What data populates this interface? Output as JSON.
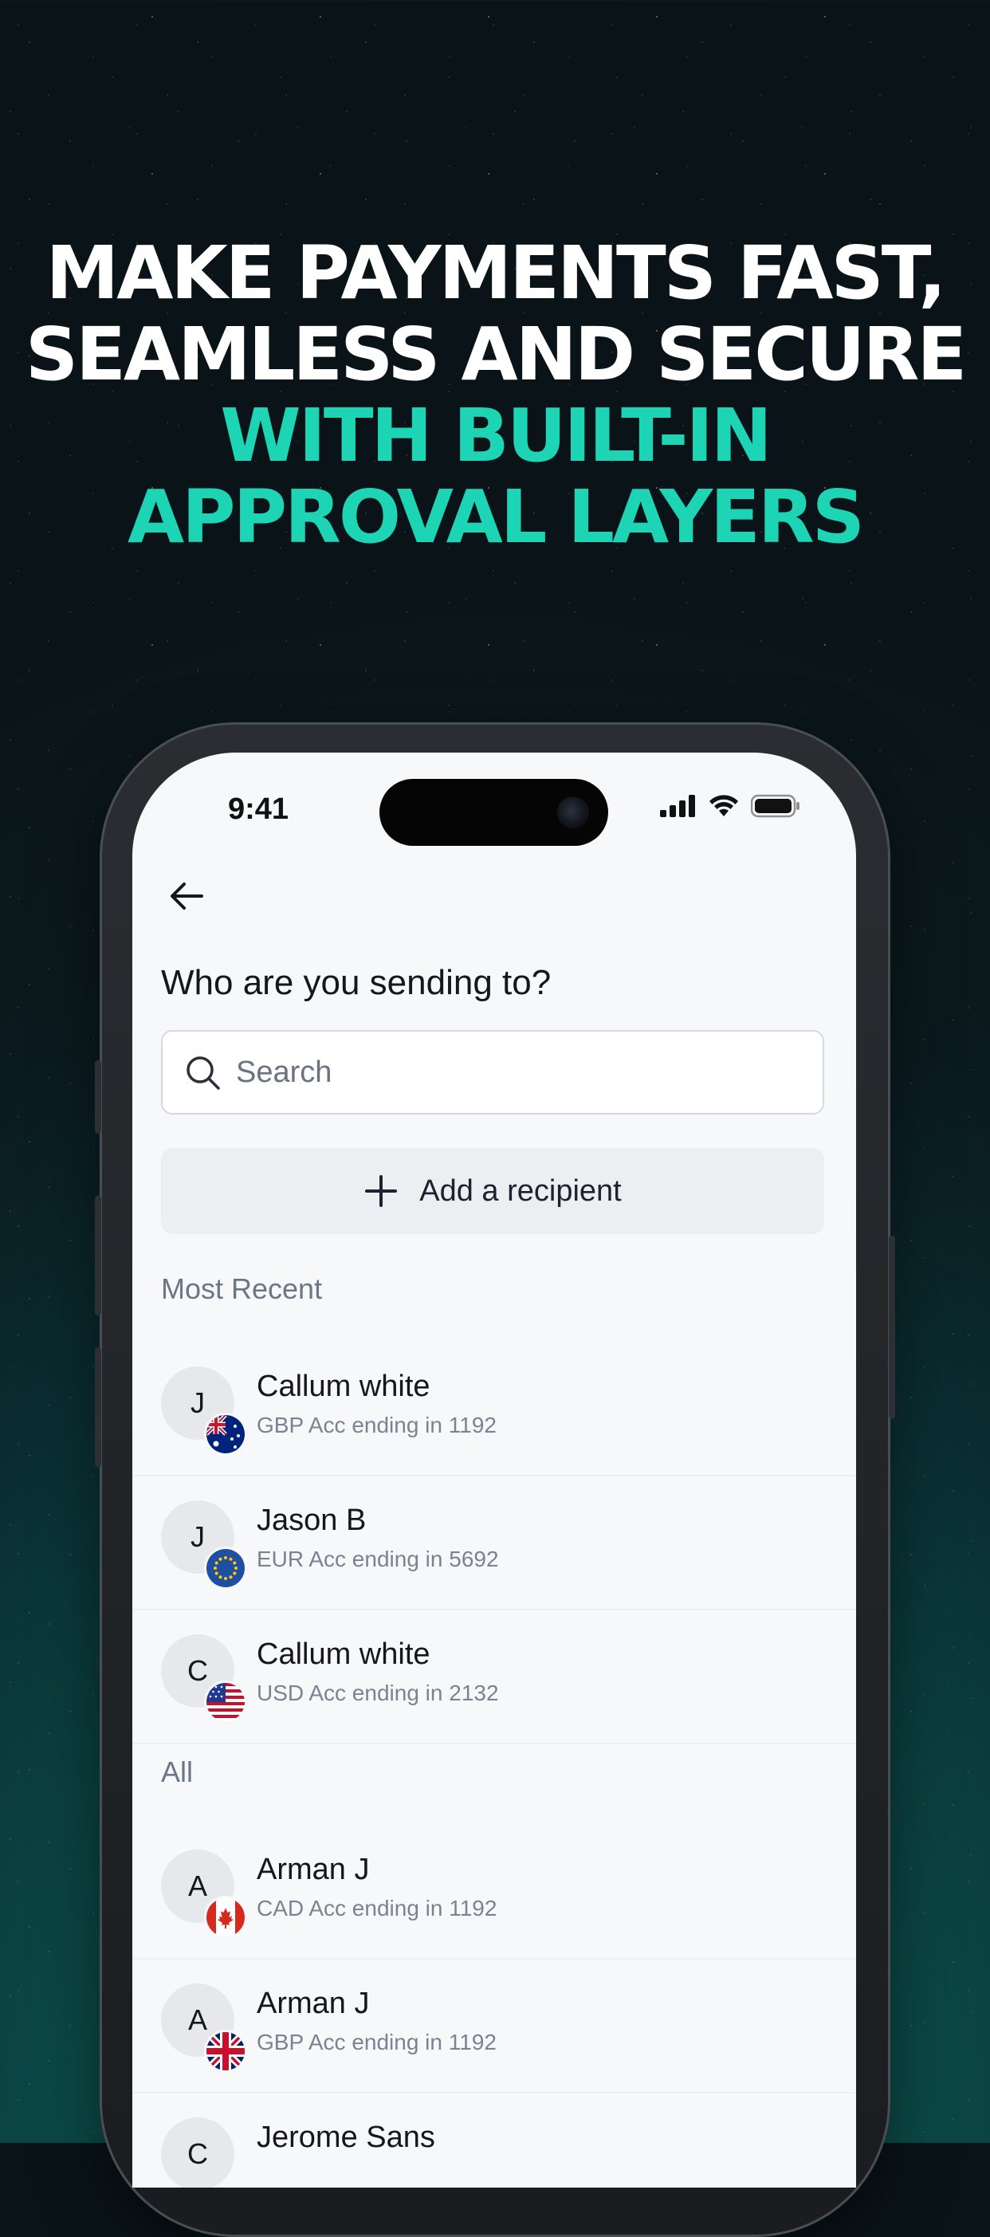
{
  "headline": {
    "line1": "MAKE PAYMENTS FAST,",
    "line2": "SEAMLESS AND SECURE",
    "line3": "WITH BUILT-IN",
    "line4": "APPROVAL LAYERS"
  },
  "colors": {
    "accent": "#1dd5b5",
    "headline": "#ffffff"
  },
  "status_bar": {
    "time": "9:41",
    "icons": [
      "cellular-icon",
      "wifi-icon",
      "battery-icon"
    ]
  },
  "screen": {
    "back_icon": "arrow-left-icon",
    "title": "Who are you sending to?",
    "search": {
      "placeholder": "Search",
      "value": "",
      "icon": "search-icon"
    },
    "add_button": {
      "label": "Add a recipient",
      "icon": "plus-icon"
    },
    "most_recent": {
      "label": "Most Recent",
      "items": [
        {
          "initial": "J",
          "name": "Callum white",
          "detail": "GBP Acc ending in 1192",
          "flag": "australia-flag-icon"
        },
        {
          "initial": "J",
          "name": "Jason B",
          "detail": "EUR Acc ending in 5692",
          "flag": "eu-flag-icon"
        },
        {
          "initial": "C",
          "name": "Callum white",
          "detail": "USD Acc ending in 2132",
          "flag": "us-flag-icon"
        }
      ]
    },
    "all": {
      "label": "All",
      "items": [
        {
          "initial": "A",
          "name": "Arman J",
          "detail": "CAD Acc ending in 1192",
          "flag": "canada-flag-icon"
        },
        {
          "initial": "A",
          "name": "Arman J",
          "detail": "GBP Acc ending in 1192",
          "flag": "uk-flag-icon"
        },
        {
          "initial": "C",
          "name": "Jerome Sans",
          "detail": "",
          "flag": ""
        }
      ]
    }
  }
}
